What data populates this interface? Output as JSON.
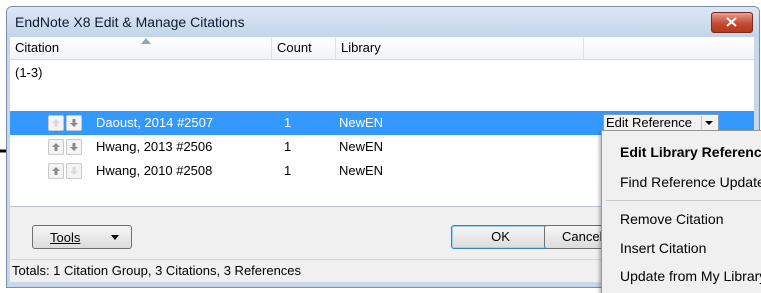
{
  "window": {
    "title": "EndNote X8 Edit & Manage Citations",
    "close_icon": "close-x-icon"
  },
  "columns": [
    {
      "label": "Citation"
    },
    {
      "label": "Count"
    },
    {
      "label": "Library"
    }
  ],
  "group": {
    "label": "(1-3)"
  },
  "rows": [
    {
      "citation": "Daoust, 2014 #2507",
      "count": "1",
      "library": "NewEN",
      "selected": true
    },
    {
      "citation": "Hwang, 2013 #2506",
      "count": "1",
      "library": "NewEN",
      "selected": false
    },
    {
      "citation": "Hwang, 2010 #2508",
      "count": "1",
      "library": "NewEN",
      "selected": false
    }
  ],
  "row_action": {
    "label": "Edit Reference"
  },
  "buttons": {
    "tools": "Tools",
    "ok": "OK",
    "cancel": "Cancel"
  },
  "status": {
    "text": "Totals: 1 Citation Group, 3 Citations, 3 References"
  },
  "context_menu": {
    "items": [
      {
        "label": "Edit Library Reference",
        "bold": true
      },
      {
        "label": "Find Reference Updates...",
        "bold": false
      },
      {
        "label": "Remove Citation",
        "bold": false
      },
      {
        "label": "Insert Citation",
        "bold": false
      },
      {
        "label": "Update from My Library...",
        "bold": false
      }
    ]
  },
  "colors": {
    "selection": "#3399ff",
    "titlebar": "#c7d8ec",
    "close_button": "#c44a31"
  }
}
